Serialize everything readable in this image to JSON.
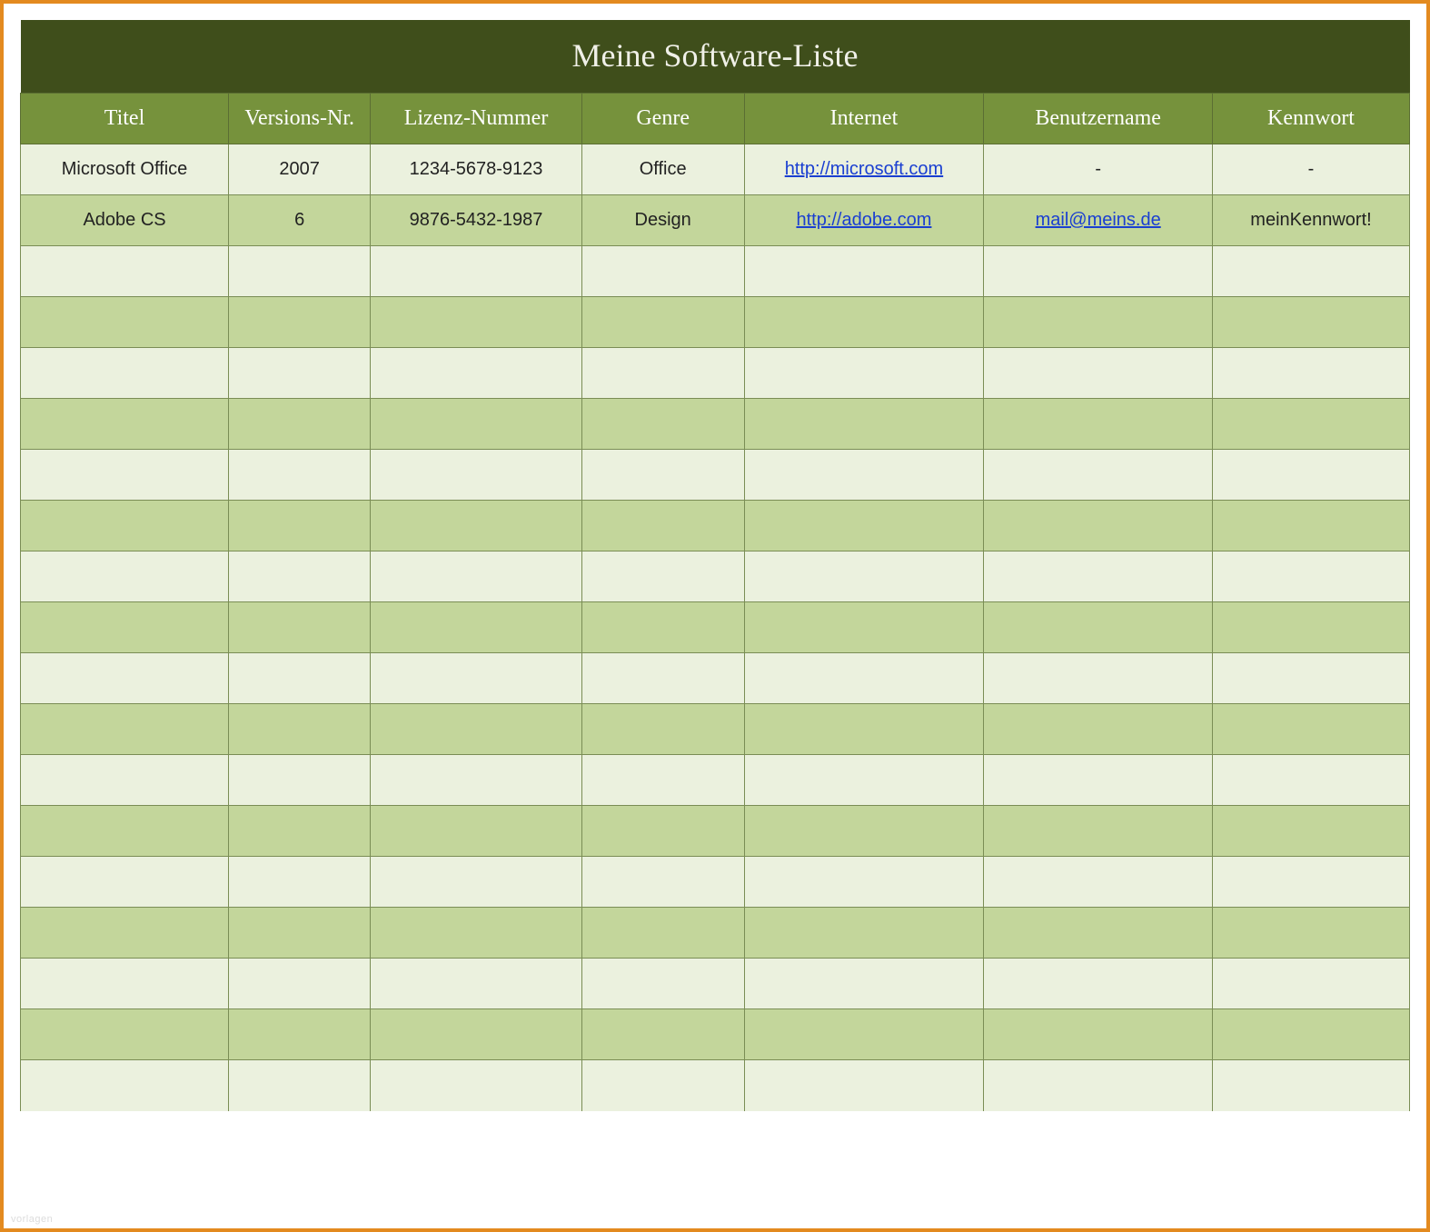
{
  "title": "Meine Software-Liste",
  "columns": [
    "Titel",
    "Versions-Nr.",
    "Lizenz-Nummer",
    "Genre",
    "Internet",
    "Benutzername",
    "Kennwort"
  ],
  "rows": [
    {
      "titel": "Microsoft Office",
      "version": "2007",
      "lizenz": "1234-5678-9123",
      "genre": "Office",
      "internet": "http://microsoft.com",
      "internet_is_link": true,
      "benutzer": "-",
      "benutzer_is_link": false,
      "kennwort": "-"
    },
    {
      "titel": "Adobe CS",
      "version": "6",
      "lizenz": "9876-5432-1987",
      "genre": "Design",
      "internet": "http://adobe.com",
      "internet_is_link": true,
      "benutzer": "mail@meins.de",
      "benutzer_is_link": true,
      "kennwort": "meinKennwort!"
    },
    {
      "titel": "",
      "version": "",
      "lizenz": "",
      "genre": "",
      "internet": "",
      "internet_is_link": false,
      "benutzer": "",
      "benutzer_is_link": false,
      "kennwort": ""
    },
    {
      "titel": "",
      "version": "",
      "lizenz": "",
      "genre": "",
      "internet": "",
      "internet_is_link": false,
      "benutzer": "",
      "benutzer_is_link": false,
      "kennwort": ""
    },
    {
      "titel": "",
      "version": "",
      "lizenz": "",
      "genre": "",
      "internet": "",
      "internet_is_link": false,
      "benutzer": "",
      "benutzer_is_link": false,
      "kennwort": ""
    },
    {
      "titel": "",
      "version": "",
      "lizenz": "",
      "genre": "",
      "internet": "",
      "internet_is_link": false,
      "benutzer": "",
      "benutzer_is_link": false,
      "kennwort": ""
    },
    {
      "titel": "",
      "version": "",
      "lizenz": "",
      "genre": "",
      "internet": "",
      "internet_is_link": false,
      "benutzer": "",
      "benutzer_is_link": false,
      "kennwort": ""
    },
    {
      "titel": "",
      "version": "",
      "lizenz": "",
      "genre": "",
      "internet": "",
      "internet_is_link": false,
      "benutzer": "",
      "benutzer_is_link": false,
      "kennwort": ""
    },
    {
      "titel": "",
      "version": "",
      "lizenz": "",
      "genre": "",
      "internet": "",
      "internet_is_link": false,
      "benutzer": "",
      "benutzer_is_link": false,
      "kennwort": ""
    },
    {
      "titel": "",
      "version": "",
      "lizenz": "",
      "genre": "",
      "internet": "",
      "internet_is_link": false,
      "benutzer": "",
      "benutzer_is_link": false,
      "kennwort": ""
    },
    {
      "titel": "",
      "version": "",
      "lizenz": "",
      "genre": "",
      "internet": "",
      "internet_is_link": false,
      "benutzer": "",
      "benutzer_is_link": false,
      "kennwort": ""
    },
    {
      "titel": "",
      "version": "",
      "lizenz": "",
      "genre": "",
      "internet": "",
      "internet_is_link": false,
      "benutzer": "",
      "benutzer_is_link": false,
      "kennwort": ""
    },
    {
      "titel": "",
      "version": "",
      "lizenz": "",
      "genre": "",
      "internet": "",
      "internet_is_link": false,
      "benutzer": "",
      "benutzer_is_link": false,
      "kennwort": ""
    },
    {
      "titel": "",
      "version": "",
      "lizenz": "",
      "genre": "",
      "internet": "",
      "internet_is_link": false,
      "benutzer": "",
      "benutzer_is_link": false,
      "kennwort": ""
    },
    {
      "titel": "",
      "version": "",
      "lizenz": "",
      "genre": "",
      "internet": "",
      "internet_is_link": false,
      "benutzer": "",
      "benutzer_is_link": false,
      "kennwort": ""
    },
    {
      "titel": "",
      "version": "",
      "lizenz": "",
      "genre": "",
      "internet": "",
      "internet_is_link": false,
      "benutzer": "",
      "benutzer_is_link": false,
      "kennwort": ""
    },
    {
      "titel": "",
      "version": "",
      "lizenz": "",
      "genre": "",
      "internet": "",
      "internet_is_link": false,
      "benutzer": "",
      "benutzer_is_link": false,
      "kennwort": ""
    },
    {
      "titel": "",
      "version": "",
      "lizenz": "",
      "genre": "",
      "internet": "",
      "internet_is_link": false,
      "benutzer": "",
      "benutzer_is_link": false,
      "kennwort": ""
    },
    {
      "titel": "",
      "version": "",
      "lizenz": "",
      "genre": "",
      "internet": "",
      "internet_is_link": false,
      "benutzer": "",
      "benutzer_is_link": false,
      "kennwort": ""
    }
  ],
  "watermark": "vorlagen"
}
